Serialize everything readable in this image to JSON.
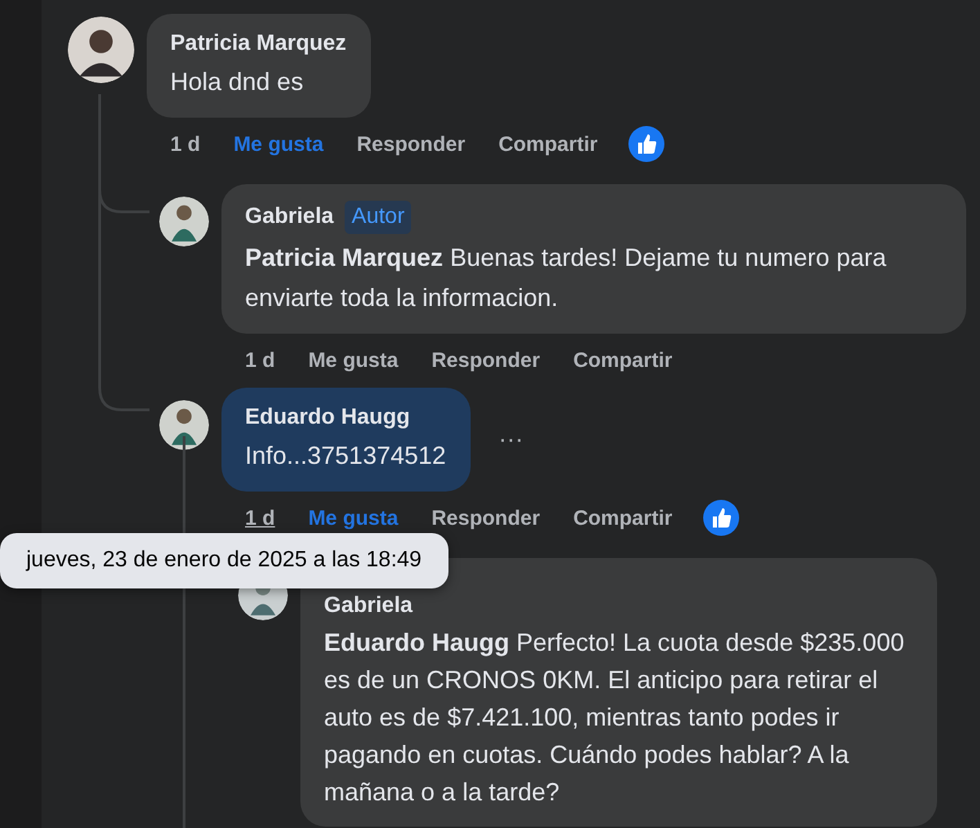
{
  "comment": {
    "author": "Patricia Marquez",
    "text": "Hola dnd es",
    "highlighted": false,
    "time": "1 d",
    "time_hovered": false,
    "like": "Me gusta",
    "liked": true,
    "reply": "Responder",
    "share": "Compartir",
    "reaction": true,
    "replies": [
      {
        "author": "Gabriela",
        "badge": "Autor",
        "text": "**Patricia Marquez** Buenas tardes! Dejame tu numero para enviarte toda la informacion.",
        "highlighted": false,
        "time": "1 d",
        "time_hovered": false,
        "like": "Me gusta",
        "liked": false,
        "reply": "Responder",
        "share": "Compartir",
        "reaction": false
      },
      {
        "author": "Eduardo Haugg",
        "text": "Info...3751374512",
        "highlighted": true,
        "menu": "···",
        "time": "1 d",
        "time_hovered": true,
        "like": "Me gusta",
        "liked": true,
        "reply": "Responder",
        "share": "Compartir",
        "reaction": true,
        "replies": [
          {
            "author": "Gabriela",
            "text": "**Eduardo Haugg** Perfecto! La cuota desde $235.000 es de un CRONOS 0KM. El anticipo para retirar el auto es de $7.421.100, mientras tanto podes ir pagando en cuotas. Cuándo podes hablar? A la mañana o a la tarde?",
            "highlighted": false
          }
        ]
      }
    ]
  },
  "tooltip": "jueves, 23 de enero de 2025 a las 18:49"
}
